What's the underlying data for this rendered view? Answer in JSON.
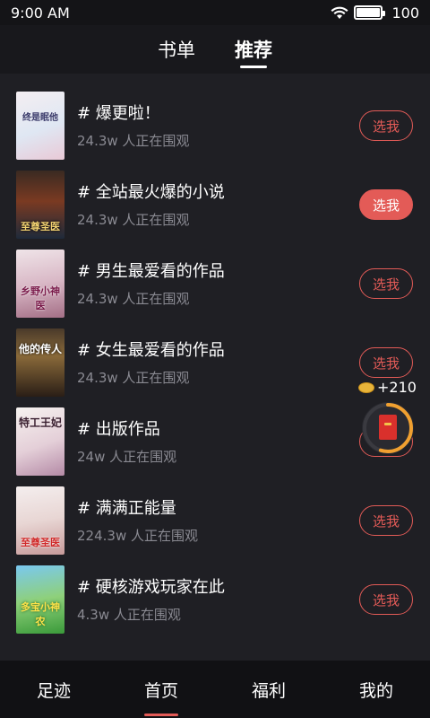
{
  "status_bar": {
    "time": "9:00 AM",
    "battery": "100"
  },
  "top_tabs": [
    {
      "label": "书单",
      "active": false
    },
    {
      "label": "推荐",
      "active": true
    }
  ],
  "list": [
    {
      "title": "# 爆更啦！",
      "viewers": "24.3w 人正在围观",
      "button": "选我",
      "selected": false,
      "cover_text": "终是眠他"
    },
    {
      "title": "# 全站最火爆的小说",
      "viewers": "24.3w 人正在围观",
      "button": "选我",
      "selected": true,
      "cover_text": "至尊圣医"
    },
    {
      "title": "# 男生最爱看的作品",
      "viewers": "24.3w 人正在围观",
      "button": "选我",
      "selected": false,
      "cover_text": "乡野小神医"
    },
    {
      "title": "# 女生最爱看的作品",
      "viewers": "24.3w 人正在围观",
      "button": "选我",
      "selected": false,
      "cover_text": "他的传人"
    },
    {
      "title": "# 出版作品",
      "viewers": "24w 人正在围观",
      "button": "选我",
      "selected": false,
      "cover_text": "特工王妃"
    },
    {
      "title": "# 满满正能量",
      "viewers": "224.3w 人正在围观",
      "button": "选我",
      "selected": false,
      "cover_text": "至尊圣医"
    },
    {
      "title": "# 硬核游戏玩家在此",
      "viewers": "4.3w 人正在围观",
      "button": "选我",
      "selected": false,
      "cover_text": "多宝小神农"
    }
  ],
  "float_widget": {
    "coins": "+210",
    "progress": 0.55
  },
  "bottom_nav": [
    {
      "label": "足迹",
      "active": false
    },
    {
      "label": "首页",
      "active": true
    },
    {
      "label": "福利",
      "active": false
    },
    {
      "label": "我的",
      "active": false
    }
  ],
  "colors": {
    "accent": "#e35b57",
    "background": "#1f1f24",
    "coin": "#e8b43a"
  }
}
